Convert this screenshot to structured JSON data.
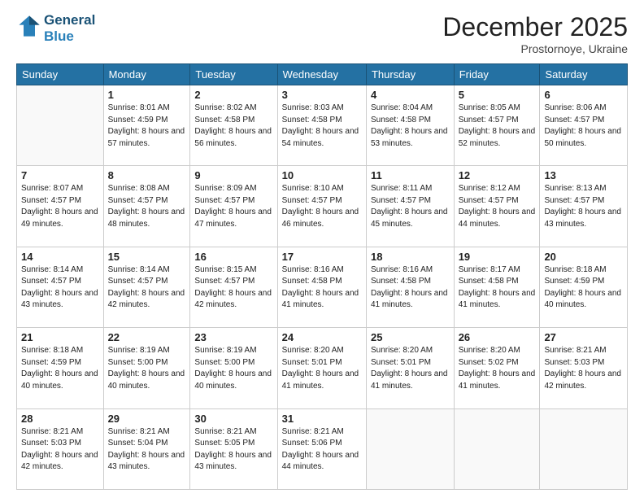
{
  "header": {
    "logo_line1": "General",
    "logo_line2": "Blue",
    "month_title": "December 2025",
    "location": "Prostornoye, Ukraine"
  },
  "days_of_week": [
    "Sunday",
    "Monday",
    "Tuesday",
    "Wednesday",
    "Thursday",
    "Friday",
    "Saturday"
  ],
  "weeks": [
    [
      {
        "day": "",
        "sunrise": "",
        "sunset": "",
        "daylight": ""
      },
      {
        "day": "1",
        "sunrise": "Sunrise: 8:01 AM",
        "sunset": "Sunset: 4:59 PM",
        "daylight": "Daylight: 8 hours and 57 minutes."
      },
      {
        "day": "2",
        "sunrise": "Sunrise: 8:02 AM",
        "sunset": "Sunset: 4:58 PM",
        "daylight": "Daylight: 8 hours and 56 minutes."
      },
      {
        "day": "3",
        "sunrise": "Sunrise: 8:03 AM",
        "sunset": "Sunset: 4:58 PM",
        "daylight": "Daylight: 8 hours and 54 minutes."
      },
      {
        "day": "4",
        "sunrise": "Sunrise: 8:04 AM",
        "sunset": "Sunset: 4:58 PM",
        "daylight": "Daylight: 8 hours and 53 minutes."
      },
      {
        "day": "5",
        "sunrise": "Sunrise: 8:05 AM",
        "sunset": "Sunset: 4:57 PM",
        "daylight": "Daylight: 8 hours and 52 minutes."
      },
      {
        "day": "6",
        "sunrise": "Sunrise: 8:06 AM",
        "sunset": "Sunset: 4:57 PM",
        "daylight": "Daylight: 8 hours and 50 minutes."
      }
    ],
    [
      {
        "day": "7",
        "sunrise": "Sunrise: 8:07 AM",
        "sunset": "Sunset: 4:57 PM",
        "daylight": "Daylight: 8 hours and 49 minutes."
      },
      {
        "day": "8",
        "sunrise": "Sunrise: 8:08 AM",
        "sunset": "Sunset: 4:57 PM",
        "daylight": "Daylight: 8 hours and 48 minutes."
      },
      {
        "day": "9",
        "sunrise": "Sunrise: 8:09 AM",
        "sunset": "Sunset: 4:57 PM",
        "daylight": "Daylight: 8 hours and 47 minutes."
      },
      {
        "day": "10",
        "sunrise": "Sunrise: 8:10 AM",
        "sunset": "Sunset: 4:57 PM",
        "daylight": "Daylight: 8 hours and 46 minutes."
      },
      {
        "day": "11",
        "sunrise": "Sunrise: 8:11 AM",
        "sunset": "Sunset: 4:57 PM",
        "daylight": "Daylight: 8 hours and 45 minutes."
      },
      {
        "day": "12",
        "sunrise": "Sunrise: 8:12 AM",
        "sunset": "Sunset: 4:57 PM",
        "daylight": "Daylight: 8 hours and 44 minutes."
      },
      {
        "day": "13",
        "sunrise": "Sunrise: 8:13 AM",
        "sunset": "Sunset: 4:57 PM",
        "daylight": "Daylight: 8 hours and 43 minutes."
      }
    ],
    [
      {
        "day": "14",
        "sunrise": "Sunrise: 8:14 AM",
        "sunset": "Sunset: 4:57 PM",
        "daylight": "Daylight: 8 hours and 43 minutes."
      },
      {
        "day": "15",
        "sunrise": "Sunrise: 8:14 AM",
        "sunset": "Sunset: 4:57 PM",
        "daylight": "Daylight: 8 hours and 42 minutes."
      },
      {
        "day": "16",
        "sunrise": "Sunrise: 8:15 AM",
        "sunset": "Sunset: 4:57 PM",
        "daylight": "Daylight: 8 hours and 42 minutes."
      },
      {
        "day": "17",
        "sunrise": "Sunrise: 8:16 AM",
        "sunset": "Sunset: 4:58 PM",
        "daylight": "Daylight: 8 hours and 41 minutes."
      },
      {
        "day": "18",
        "sunrise": "Sunrise: 8:16 AM",
        "sunset": "Sunset: 4:58 PM",
        "daylight": "Daylight: 8 hours and 41 minutes."
      },
      {
        "day": "19",
        "sunrise": "Sunrise: 8:17 AM",
        "sunset": "Sunset: 4:58 PM",
        "daylight": "Daylight: 8 hours and 41 minutes."
      },
      {
        "day": "20",
        "sunrise": "Sunrise: 8:18 AM",
        "sunset": "Sunset: 4:59 PM",
        "daylight": "Daylight: 8 hours and 40 minutes."
      }
    ],
    [
      {
        "day": "21",
        "sunrise": "Sunrise: 8:18 AM",
        "sunset": "Sunset: 4:59 PM",
        "daylight": "Daylight: 8 hours and 40 minutes."
      },
      {
        "day": "22",
        "sunrise": "Sunrise: 8:19 AM",
        "sunset": "Sunset: 5:00 PM",
        "daylight": "Daylight: 8 hours and 40 minutes."
      },
      {
        "day": "23",
        "sunrise": "Sunrise: 8:19 AM",
        "sunset": "Sunset: 5:00 PM",
        "daylight": "Daylight: 8 hours and 40 minutes."
      },
      {
        "day": "24",
        "sunrise": "Sunrise: 8:20 AM",
        "sunset": "Sunset: 5:01 PM",
        "daylight": "Daylight: 8 hours and 41 minutes."
      },
      {
        "day": "25",
        "sunrise": "Sunrise: 8:20 AM",
        "sunset": "Sunset: 5:01 PM",
        "daylight": "Daylight: 8 hours and 41 minutes."
      },
      {
        "day": "26",
        "sunrise": "Sunrise: 8:20 AM",
        "sunset": "Sunset: 5:02 PM",
        "daylight": "Daylight: 8 hours and 41 minutes."
      },
      {
        "day": "27",
        "sunrise": "Sunrise: 8:21 AM",
        "sunset": "Sunset: 5:03 PM",
        "daylight": "Daylight: 8 hours and 42 minutes."
      }
    ],
    [
      {
        "day": "28",
        "sunrise": "Sunrise: 8:21 AM",
        "sunset": "Sunset: 5:03 PM",
        "daylight": "Daylight: 8 hours and 42 minutes."
      },
      {
        "day": "29",
        "sunrise": "Sunrise: 8:21 AM",
        "sunset": "Sunset: 5:04 PM",
        "daylight": "Daylight: 8 hours and 43 minutes."
      },
      {
        "day": "30",
        "sunrise": "Sunrise: 8:21 AM",
        "sunset": "Sunset: 5:05 PM",
        "daylight": "Daylight: 8 hours and 43 minutes."
      },
      {
        "day": "31",
        "sunrise": "Sunrise: 8:21 AM",
        "sunset": "Sunset: 5:06 PM",
        "daylight": "Daylight: 8 hours and 44 minutes."
      },
      {
        "day": "",
        "sunrise": "",
        "sunset": "",
        "daylight": ""
      },
      {
        "day": "",
        "sunrise": "",
        "sunset": "",
        "daylight": ""
      },
      {
        "day": "",
        "sunrise": "",
        "sunset": "",
        "daylight": ""
      }
    ]
  ]
}
